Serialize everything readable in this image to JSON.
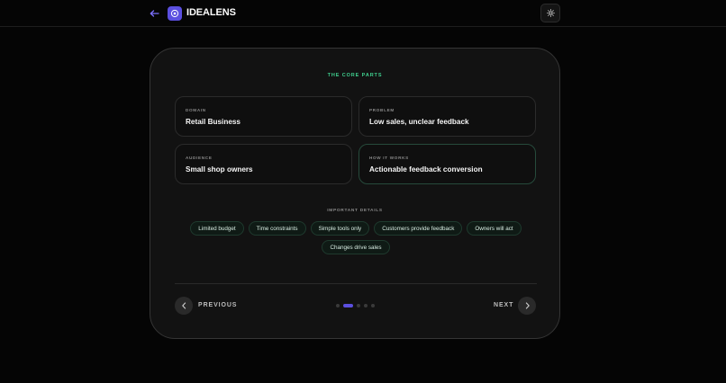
{
  "header": {
    "brand": "IDEALENS",
    "back_icon": "arrow-left-icon",
    "logo_icon": "lens-icon",
    "theme_icon": "sun-icon"
  },
  "card": {
    "title": "THE CORE PARTS",
    "parts": [
      {
        "label": "DOMAIN",
        "value": "Retail Business"
      },
      {
        "label": "PROBLEM",
        "value": "Low sales, unclear feedback"
      },
      {
        "label": "AUDIENCE",
        "value": "Small shop owners"
      },
      {
        "label": "HOW IT WORKS",
        "value": "Actionable feedback conversion"
      }
    ],
    "details_title": "IMPORTANT DETAILS",
    "details": [
      "Limited budget",
      "Time constraints",
      "Simple tools only",
      "Customers provide feedback",
      "Owners will act",
      "Changes drive sales"
    ],
    "nav": {
      "previous": "PREVIOUS",
      "next": "NEXT",
      "step_count": 5,
      "current_step": 2
    }
  },
  "colors": {
    "accent": "#5b4fe0",
    "section_title": "#3fcf8e",
    "background": "#050505",
    "card": "#121212"
  }
}
